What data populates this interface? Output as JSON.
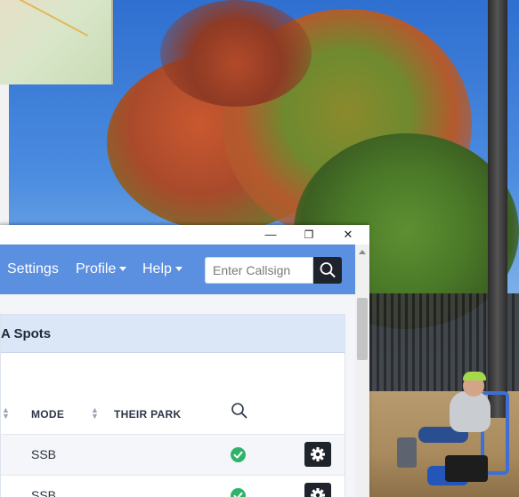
{
  "window": {
    "minimize_glyph": "—",
    "restore_glyph": "❐",
    "close_glyph": "✕"
  },
  "navbar": {
    "settings_label": "Settings",
    "profile_label": "Profile",
    "help_label": "Help",
    "search_placeholder": "Enter Callsign",
    "search_icon": "search-icon"
  },
  "panel": {
    "title": "A Spots"
  },
  "table": {
    "columns": [
      "MODE",
      "THEIR PARK"
    ],
    "rows": [
      {
        "mode": "SSB",
        "status_icon": "check-circle-icon",
        "action_icon": "gear-icon"
      },
      {
        "mode": "SSB",
        "status_icon": "check-circle-icon",
        "action_icon": "gear-icon"
      }
    ]
  },
  "colors": {
    "navbar": "#5b8fe0",
    "panel_header": "#dbe6f7",
    "success": "#2fb36b",
    "dark_button": "#1f232b"
  }
}
